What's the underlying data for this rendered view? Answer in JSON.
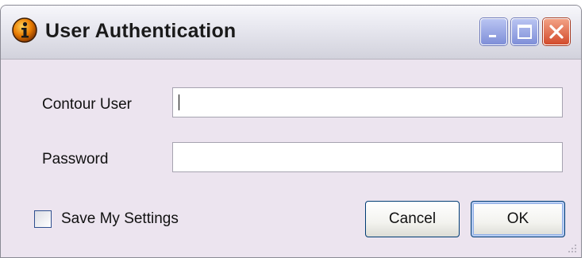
{
  "window": {
    "title": "User Authentication",
    "icon": "info-icon",
    "controls": {
      "minimize_icon": "minimize-icon",
      "maximize_icon": "maximize-icon",
      "close_icon": "close-icon"
    }
  },
  "form": {
    "user_label": "Contour User",
    "user_value": "",
    "password_label": "Password",
    "password_value": ""
  },
  "options": {
    "save_settings_label": "Save My Settings",
    "save_settings_checked": false
  },
  "buttons": {
    "cancel_label": "Cancel",
    "ok_label": "OK"
  },
  "colors": {
    "window_bg": "#ece4ef",
    "close_red": "#d24b2c",
    "control_blue": "#7f8fd8",
    "info_icon_orange": "#e87a00"
  }
}
